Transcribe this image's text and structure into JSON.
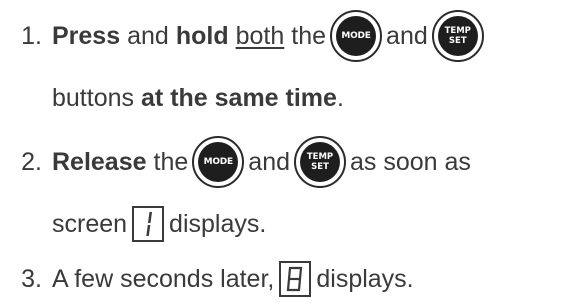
{
  "steps": [
    {
      "number": "1.",
      "line1": {
        "w1": "Press",
        "w2": "and",
        "w3": "hold",
        "w4": "both",
        "w5": "the",
        "w6": "and"
      },
      "line2": {
        "w1": "buttons",
        "w2": "at the same time",
        "w3": "."
      }
    },
    {
      "number": "2.",
      "line1": {
        "w1": "Release",
        "w2": "the",
        "w3": "and",
        "w4": "as soon as"
      },
      "line2": {
        "w1": "screen",
        "w2": "displays."
      }
    },
    {
      "number": "3.",
      "line1": {
        "w1": "A few seconds later,",
        "w2": "displays."
      }
    }
  ],
  "icons": {
    "mode_button": {
      "name": "mode-button-icon",
      "label": "MODE"
    },
    "temp_set_button": {
      "name": "temp-set-button-icon",
      "label_top": "TEMP",
      "label_bottom": "SET"
    },
    "display_one": {
      "name": "seven-segment-one-icon",
      "glyph": "1"
    },
    "display_eight": {
      "name": "seven-segment-eight-icon",
      "glyph": "8"
    }
  },
  "colors": {
    "text": "#3a3a3a",
    "button_fill": "#1e1e1e"
  }
}
